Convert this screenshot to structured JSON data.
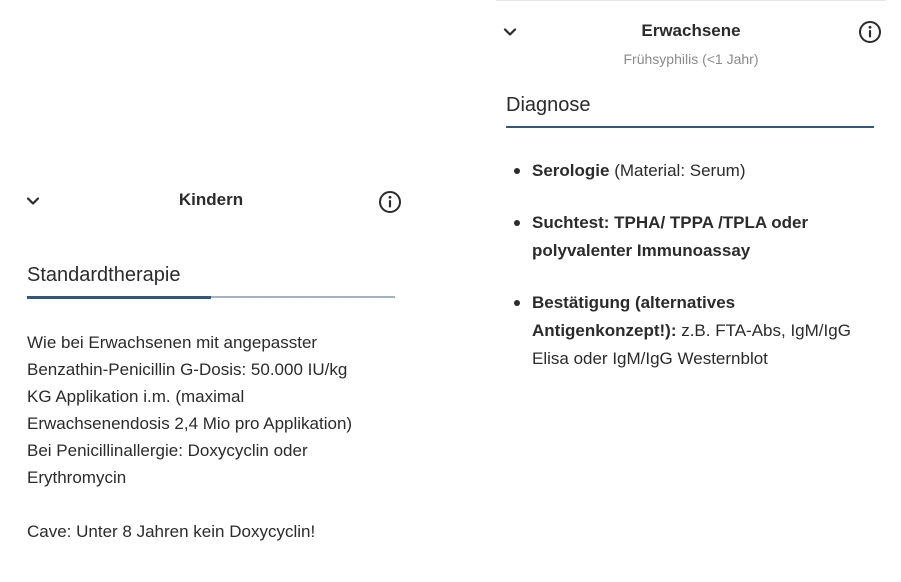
{
  "left_card": {
    "title": "Kindern",
    "chevron_icon": "chevron-down-icon",
    "info_icon": "info-circle-icon",
    "section_title": "Standardtherapie",
    "lines": [
      "Wie bei Erwachsenen mit angepasster",
      "Benzathin-Penicillin G-Dosis: 50.000 IU/kg",
      "KG Applikation i.m. (maximal",
      "Erwachsenendosis 2,4 Mio pro Applikation)",
      "Bei Penicillinallergie: Doxycyclin oder",
      "Erythromycin"
    ],
    "caution": "Cave: Unter 8 Jahren kein Doxycyclin!"
  },
  "right_card": {
    "title": "Erwachsene",
    "subtitle": "Frühsyphilis (<1 Jahr)",
    "chevron_icon": "chevron-down-icon",
    "info_icon": "info-circle-icon",
    "section_title": "Diagnose",
    "bullets": [
      {
        "bold": "Serologie",
        "text": " (Material: Serum)"
      },
      {
        "bold": "Suchtest: TPHA/ TPPA /TPLA oder polyvalenter Immunoassay",
        "text": ""
      },
      {
        "bold": "Bestätigung (alternatives Antigenkonzept!):",
        "text": " z.B. FTA-Abs, IgM/IgG Elisa oder IgM/IgG Westernblot"
      }
    ]
  },
  "colors": {
    "accent": "#2f5a7e",
    "underline_base": "#9fb4c3",
    "text": "#2b2b2b",
    "muted": "#8a8a8a"
  }
}
